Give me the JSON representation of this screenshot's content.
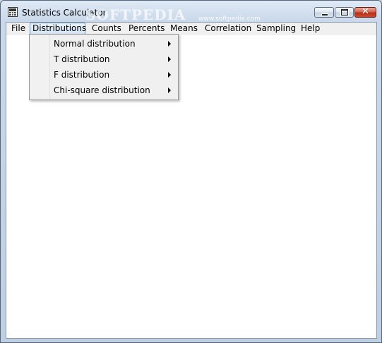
{
  "window": {
    "title": "Statistics Calculator",
    "watermark": "SOFTPEDIA",
    "watermark_url": "www.softpedia.com",
    "close_glyph": "✕"
  },
  "menubar": {
    "items": [
      {
        "label": "File"
      },
      {
        "label": "Distributions"
      },
      {
        "label": "Counts"
      },
      {
        "label": "Percents"
      },
      {
        "label": "Means"
      },
      {
        "label": "Correlation"
      },
      {
        "label": "Sampling"
      },
      {
        "label": "Help"
      }
    ],
    "active": "Distributions"
  },
  "dropdown": {
    "items": [
      {
        "label": "Normal distribution",
        "submenu": true
      },
      {
        "label": "T distribution",
        "submenu": true
      },
      {
        "label": "F distribution",
        "submenu": true
      },
      {
        "label": "Chi-square distribution",
        "submenu": true
      }
    ]
  },
  "colors": {
    "close_button": "#c9492f",
    "menu_highlight_border": "#6f93b7"
  },
  "icons": [
    "calculator-icon",
    "minimize-icon",
    "maximize-icon",
    "close-icon",
    "submenu-arrow-icon"
  ]
}
